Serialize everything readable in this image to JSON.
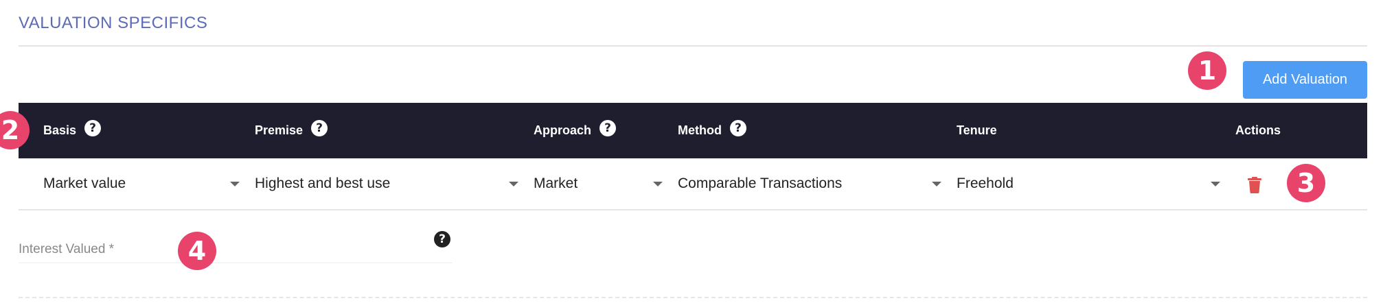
{
  "section": {
    "title": "VALUATION SPECIFICS"
  },
  "toolbar": {
    "add_label": "Add Valuation"
  },
  "badges": [
    "1",
    "2",
    "3",
    "4"
  ],
  "table": {
    "headers": {
      "basis": "Basis",
      "premise": "Premise",
      "approach": "Approach",
      "method": "Method",
      "tenure": "Tenure",
      "actions": "Actions"
    },
    "help_glyph": "?",
    "row": {
      "basis": "Market value",
      "premise": "Highest and best use",
      "approach": "Market",
      "method": "Comparable Transactions",
      "tenure": "Freehold"
    }
  },
  "interest_valued": {
    "label": "Interest Valued *",
    "help_glyph": "?"
  },
  "colors": {
    "accent": "#4f9cf5",
    "header_bg": "#1f1e2e",
    "badge": "#e8436b",
    "title": "#5b6bb5",
    "delete": "#e05252"
  },
  "icons": {
    "help": "help-circle-icon",
    "caret": "chevron-down-icon",
    "delete": "trash-icon"
  }
}
